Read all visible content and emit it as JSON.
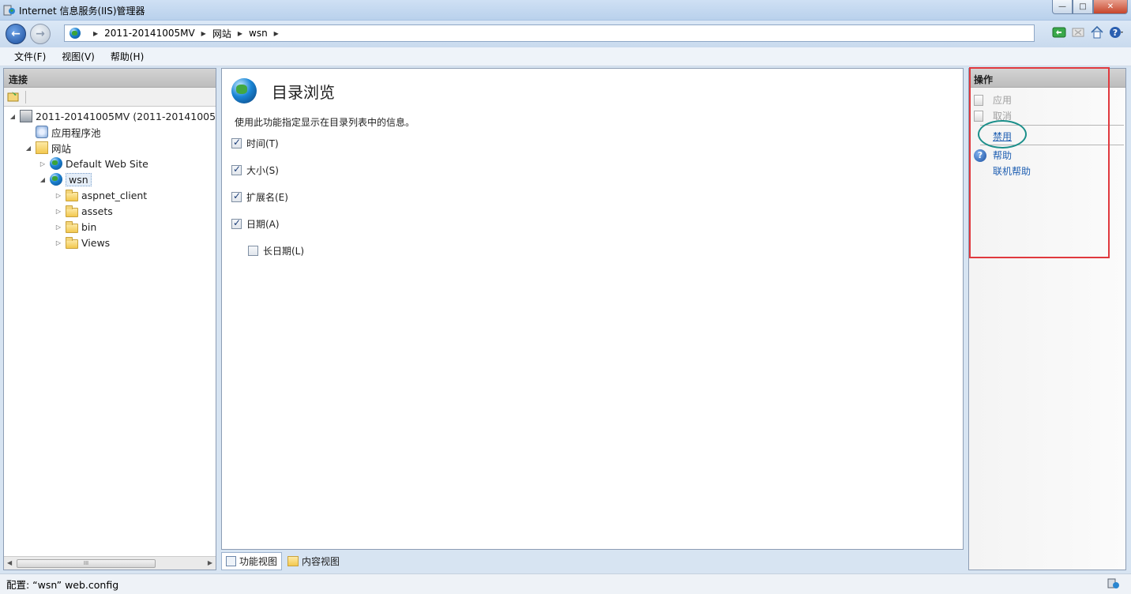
{
  "window": {
    "title": "Internet 信息服务(IIS)管理器",
    "minimize": "—",
    "maximize": "□",
    "close": "✕"
  },
  "navigation": {
    "back": "←",
    "forward": "→",
    "breadcrumbs": [
      "2011-20141005MV",
      "网站",
      "wsn"
    ],
    "separator": "▶",
    "tool_icons": [
      "refresh-icon",
      "stop-icon",
      "home-icon",
      "help-icon"
    ]
  },
  "menu": {
    "file": "文件(F)",
    "view": "视图(V)",
    "help": "帮助(H)"
  },
  "connections": {
    "header": "连接",
    "tree": {
      "server": "2011-20141005MV (2011-20141005MV",
      "app_pools": "应用程序池",
      "sites": "网站",
      "default_site": "Default Web Site",
      "wsn": "wsn",
      "folders": [
        "aspnet_client",
        "assets",
        "bin",
        "Views"
      ]
    },
    "scroll_grip": "III"
  },
  "feature": {
    "title": "目录浏览",
    "description": "使用此功能指定显示在目录列表中的信息。",
    "options": {
      "time": {
        "label": "时间(T)",
        "checked": true
      },
      "size": {
        "label": "大小(S)",
        "checked": true
      },
      "extension": {
        "label": "扩展名(E)",
        "checked": true
      },
      "date": {
        "label": "日期(A)",
        "checked": true
      },
      "long_date": {
        "label": "长日期(L)",
        "checked": false
      }
    }
  },
  "view_tabs": {
    "features": "功能视图",
    "content": "内容视图"
  },
  "actions": {
    "header": "操作",
    "apply": "应用",
    "cancel": "取消",
    "disable": "禁用",
    "help": "帮助",
    "online_help": "联机帮助"
  },
  "status": {
    "text": "配置: “wsn” web.config"
  },
  "colors": {
    "annotation_box": "#e0393e",
    "annotation_ellipse": "#1b8f8a",
    "link": "#1f5fb2",
    "disabled": "#a0a0a0"
  }
}
